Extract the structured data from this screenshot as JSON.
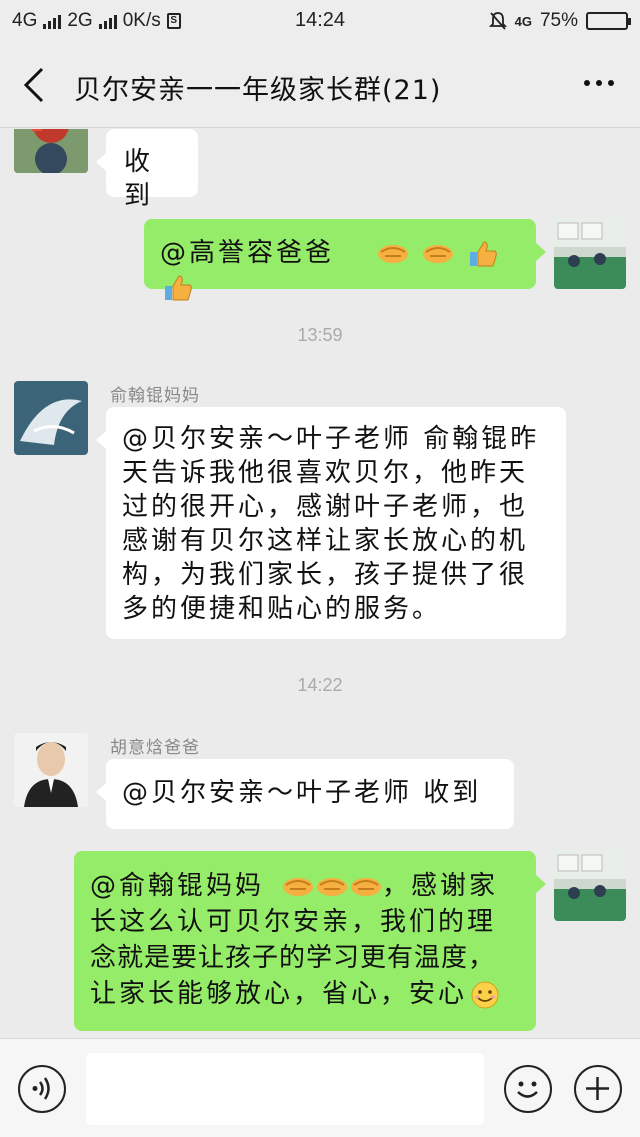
{
  "status_bar": {
    "network1": "4G",
    "network2": "2G",
    "speed": "0K/s",
    "time": "14:24",
    "lte": "4G",
    "battery": "75%",
    "battery_level": 0.75
  },
  "header": {
    "title": "贝尔安亲一一年级家长群(21)"
  },
  "messages": [
    {
      "type": "in",
      "text": "收到"
    },
    {
      "type": "out",
      "text": "@高誉容爸爸",
      "emojis": [
        "handshake",
        "handshake",
        "thumbs-up",
        "thumbs-up"
      ]
    },
    {
      "type": "time",
      "text": "13:59"
    },
    {
      "type": "in",
      "sender": "俞翰锟妈妈",
      "lines": [
        "@贝尔安亲～叶子老师 俞翰锟昨",
        "天告诉我他很喜欢贝尔，他昨天",
        "过的很开心，感谢叶子老师，也",
        "感谢有贝尔这样让家长放心的机",
        "构，为我们家长，孩子提供了很",
        "多的便捷和贴心的服务。"
      ]
    },
    {
      "type": "time",
      "text": "14:22"
    },
    {
      "type": "in",
      "sender": "胡意焓爸爸",
      "text": "@贝尔安亲～叶子老师 收到"
    },
    {
      "type": "out",
      "lines": [
        "@俞翰锟妈妈",
        "长这么认可贝尔安亲，我们的理",
        "念就是要让孩子的学习更有温度，",
        "让家长能够放心，省心，安心"
      ],
      "line1_suffix": "，感谢家"
    }
  ],
  "input": {
    "placeholder": ""
  },
  "colors": {
    "outgoing_bubble": "#95ec69",
    "incoming_bubble": "#ffffff",
    "background": "#ebebeb"
  },
  "icons": [
    "back-arrow-icon",
    "more-icon",
    "voice-icon",
    "emoji-icon",
    "plus-icon",
    "handshake-icon",
    "thumbs-up-icon",
    "smile-icon"
  ]
}
